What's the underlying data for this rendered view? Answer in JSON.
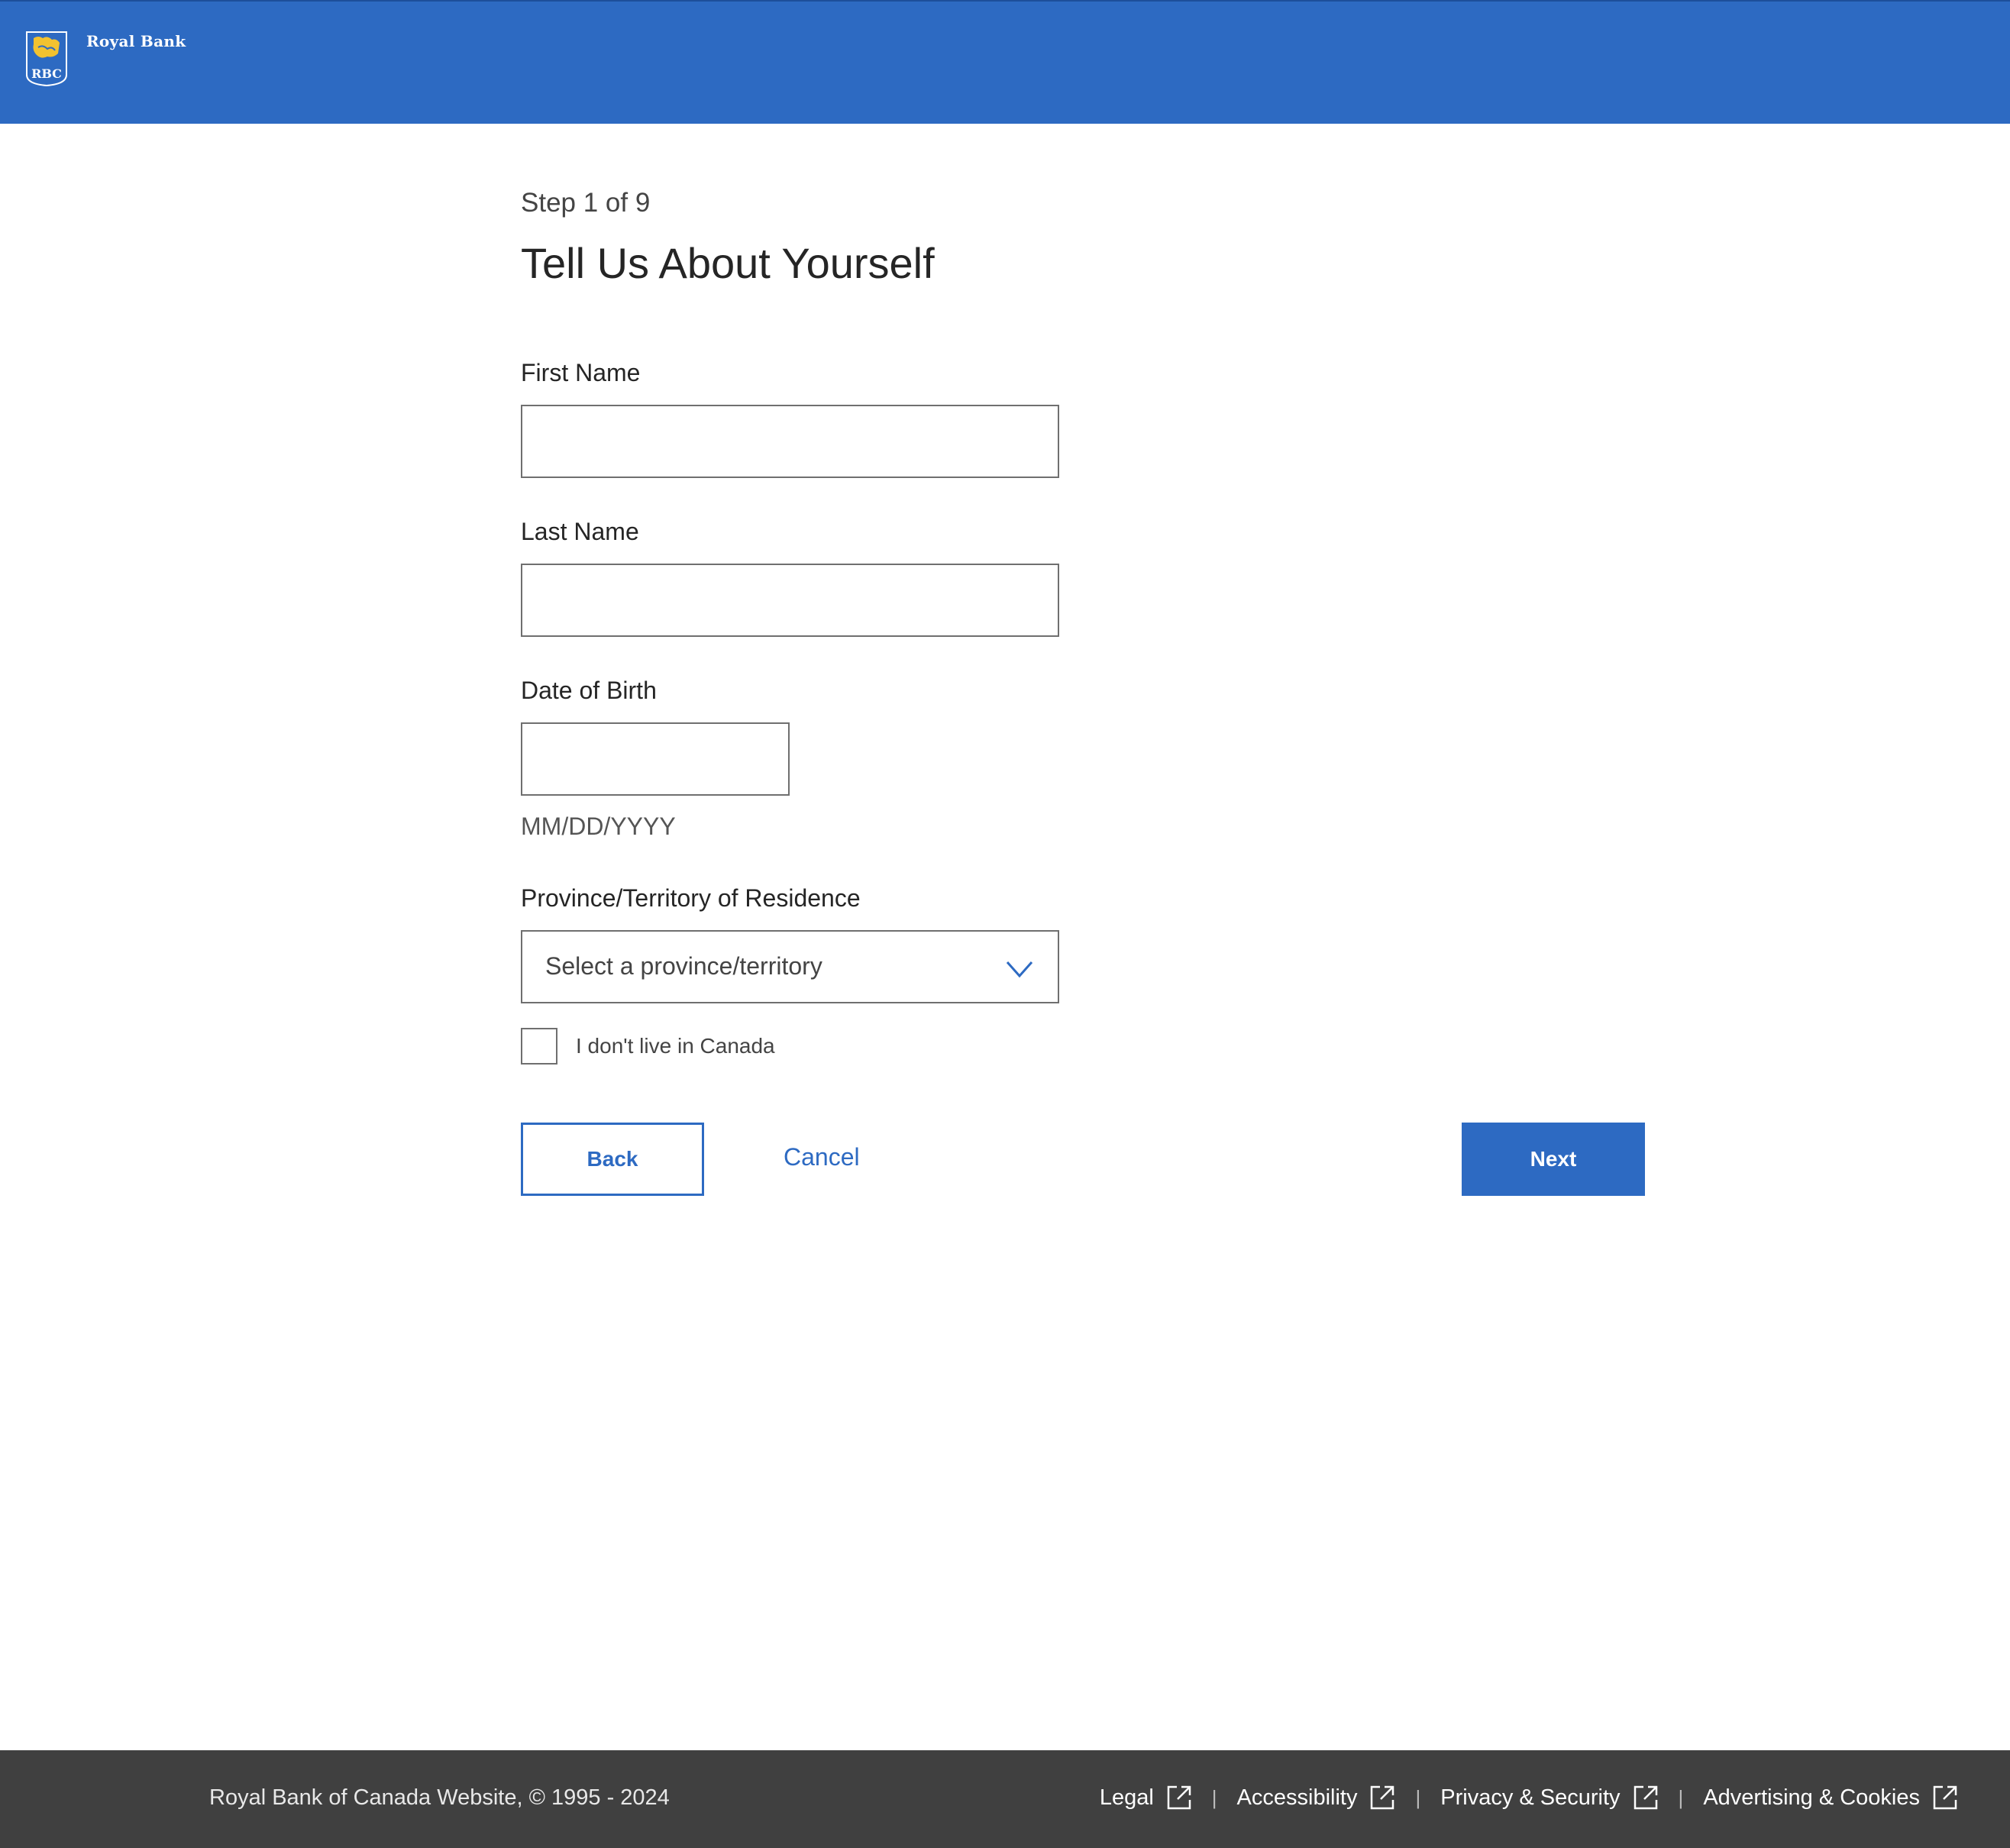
{
  "header": {
    "brand_name": "Royal Bank",
    "logo_text": "RBC",
    "colors": {
      "primary": "#2d6ac2",
      "logo_gold": "#f2c230"
    }
  },
  "form": {
    "step": "Step 1 of 9",
    "title": "Tell Us About Yourself",
    "first_name": {
      "label": "First Name",
      "value": ""
    },
    "last_name": {
      "label": "Last Name",
      "value": ""
    },
    "dob": {
      "label": "Date of Birth",
      "value": "",
      "hint": "MM/DD/YYYY"
    },
    "province": {
      "label": "Province/Territory of Residence",
      "selected": "Select a province/territory",
      "icon": "chevron-down-icon"
    },
    "not_in_canada": {
      "label": "I don't live in Canada",
      "checked": false
    },
    "buttons": {
      "back": "Back",
      "cancel": "Cancel",
      "next": "Next"
    }
  },
  "footer": {
    "copyright": "Royal Bank of Canada Website, © 1995 - 2024",
    "links": [
      "Legal",
      "Accessibility",
      "Privacy & Security",
      "Advertising & Cookies"
    ],
    "separator": "|",
    "link_icon": "external-link-icon"
  }
}
